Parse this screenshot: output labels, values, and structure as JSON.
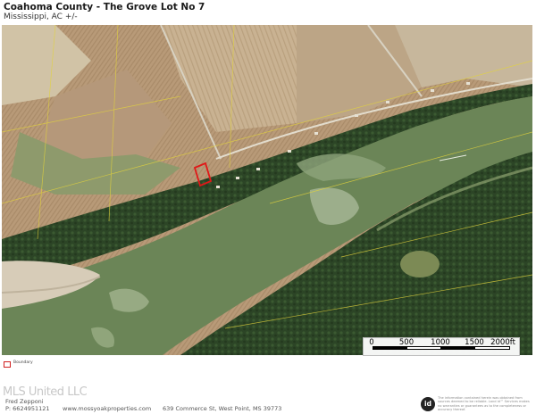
{
  "header": {
    "title": "Coahoma County - The Grove Lot No 7",
    "subtitle": "Mississippi, AC +/-"
  },
  "map": {
    "colors": {
      "water": "#6e8759",
      "forest": "#2f4a28",
      "field": "#b99e7c",
      "field_light": "#cfc2a7",
      "sandbar": "#d9cfbe",
      "parcel_outline": "#e01818",
      "parcel_lines": "#e0d040"
    },
    "scale_bar": {
      "labels": [
        "0",
        "500",
        "1000",
        "1500",
        "2000ft"
      ]
    },
    "legend": {
      "label": "Boundary"
    }
  },
  "footer": {
    "watermark": "MLS United LLC",
    "agent_name": "Fred Zepponi",
    "phone": "P: 6624951121",
    "website": "www.mossyoakproperties.com",
    "address": "639 Commerce St, West Point, MS 39773",
    "logo_text": "id",
    "disclaimer": "The information contained herein was obtained from sources deemed to be reliable. Land id™ Services makes no warranties or guarantees as to the completeness or accuracy thereof."
  }
}
